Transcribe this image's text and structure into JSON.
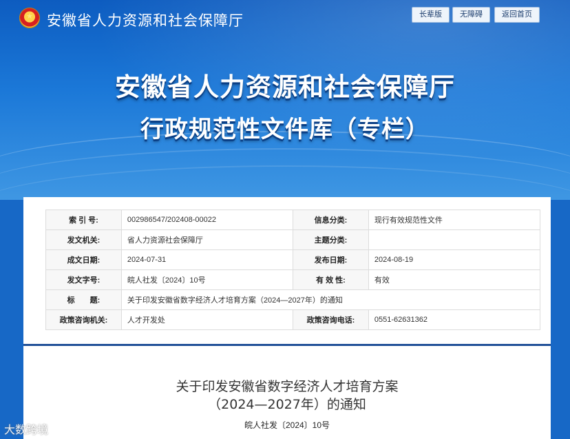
{
  "header": {
    "site_name": "安徽省人力资源和社会保障厅",
    "buttons": [
      "长辈版",
      "无障碍",
      "返回首页"
    ],
    "title": "安徽省人力资源和社会保障厅",
    "subtitle": "行政规范性文件库（专栏）"
  },
  "meta": {
    "rows": [
      {
        "k1": "索 引 号:",
        "v1": "002986547/202408-00022",
        "k2": "信息分类:",
        "v2": "现行有效规范性文件"
      },
      {
        "k1": "发文机关:",
        "v1": "省人力资源社会保障厅",
        "k2": "主题分类:",
        "v2": ""
      },
      {
        "k1": "成文日期:",
        "v1": "2024-07-31",
        "k2": "发布日期:",
        "v2": "2024-08-19"
      },
      {
        "k1": "发文字号:",
        "v1": "皖人社发〔2024〕10号",
        "k2": "有 效 性:",
        "v2": "有效"
      }
    ],
    "title_label": "标　　题:",
    "title_value": "关于印发安徽省数字经济人才培育方案（2024—2027年）的通知",
    "contact": {
      "k1": "政策咨询机关:",
      "v1": "人才开发处",
      "k2": "政策咨询电话:",
      "v2": "0551-62631362"
    }
  },
  "document": {
    "title_line1": "关于印发安徽省数字经济人才培育方案",
    "title_line2": "（2024—2027年）的通知",
    "number": "皖人社发〔2024〕10号"
  },
  "watermark": "大数跨境",
  "colors": {
    "banner": "#1768c6",
    "divider": "#1f4f97"
  }
}
